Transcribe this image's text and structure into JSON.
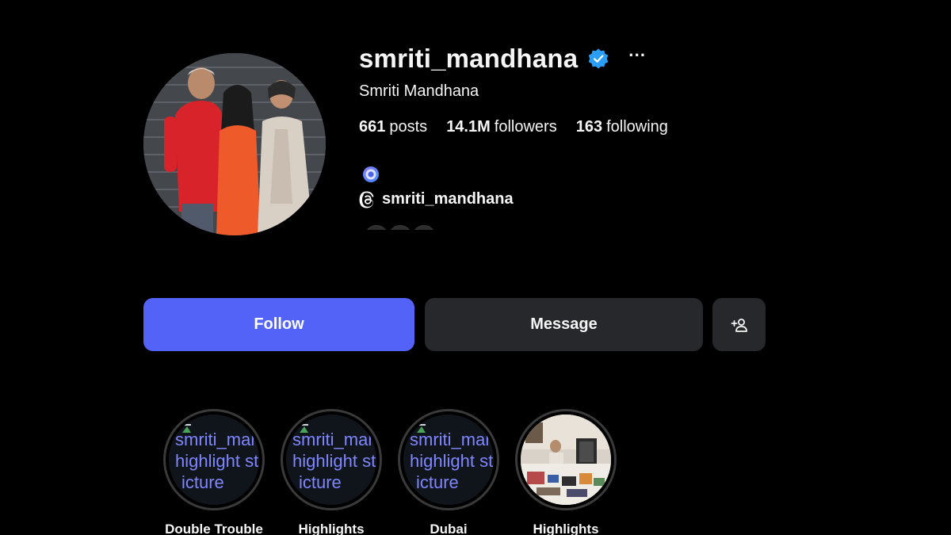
{
  "profile": {
    "username": "smriti_mandhana",
    "full_name": "Smriti Mandhana",
    "verified": true,
    "more_icon": "ellipsis-icon",
    "stats": {
      "posts_count": "661",
      "posts_label": "posts",
      "followers_count": "14.1M",
      "followers_label": "followers",
      "following_count": "163",
      "following_label": "following"
    },
    "threads_handle": "smriti_mandhana"
  },
  "actions": {
    "follow_label": "Follow",
    "message_label": "Message",
    "suggest_icon": "add-user-icon"
  },
  "highlights": [
    {
      "label": "Double Trouble",
      "broken_line1": "smriti_manc",
      "broken_line2": "highlight sto",
      "broken_line3": "icture"
    },
    {
      "label": "Highlights",
      "broken_line1": "smriti_manc",
      "broken_line2": "highlight sto",
      "broken_line3": "icture"
    },
    {
      "label": "Dubai",
      "broken_line1": "smriti_manc",
      "broken_line2": "highlight sto",
      "broken_line3": "icture"
    },
    {
      "label": "Highlights"
    }
  ],
  "colors": {
    "background": "#000000",
    "follow_button": "#5363f7",
    "secondary_button": "#26282c",
    "verified_badge": "#2a9df4",
    "text": "#f5f5f5"
  }
}
